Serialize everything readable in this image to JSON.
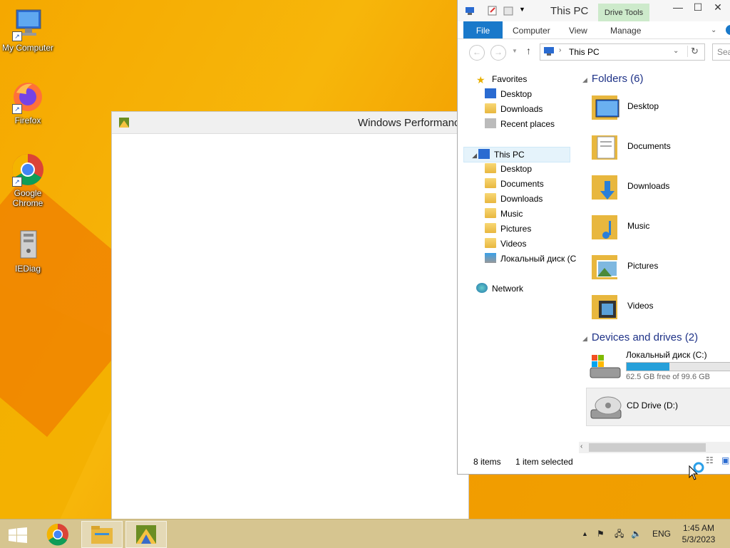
{
  "desktop": {
    "icons": [
      {
        "label": "My Computer",
        "icon": "computer-icon"
      },
      {
        "label": "Firefox",
        "icon": "firefox-icon"
      },
      {
        "label": "Google Chrome",
        "icon": "chrome-icon"
      },
      {
        "label": "IEDiag",
        "icon": "iediag-icon"
      }
    ]
  },
  "perf_window": {
    "title": "Windows Performance"
  },
  "explorer": {
    "title": "This PC",
    "context_tab": "Drive Tools",
    "tabs": [
      "File",
      "Computer",
      "View",
      "Manage"
    ],
    "address": "This PC",
    "search_placeholder": "Sea",
    "nav": {
      "favorites": "Favorites",
      "fav_items": [
        "Desktop",
        "Downloads",
        "Recent places"
      ],
      "this_pc": "This PC",
      "pc_items": [
        "Desktop",
        "Documents",
        "Downloads",
        "Music",
        "Pictures",
        "Videos",
        "Локальный диск (C"
      ],
      "network": "Network"
    },
    "folders_header": "Folders (6)",
    "folders": [
      "Desktop",
      "Documents",
      "Downloads",
      "Music",
      "Pictures",
      "Videos"
    ],
    "devices_header": "Devices and drives (2)",
    "drives": [
      {
        "name": "Локальный диск (C:)",
        "free": "62.5 GB free of 99.6 GB",
        "used_fraction": 0.373
      },
      {
        "name": "CD Drive (D:)"
      }
    ],
    "status": {
      "items": "8 items",
      "selected": "1 item selected"
    }
  },
  "taskbar": {
    "language": "ENG",
    "time": "1:45 AM",
    "date": "5/3/2023"
  }
}
